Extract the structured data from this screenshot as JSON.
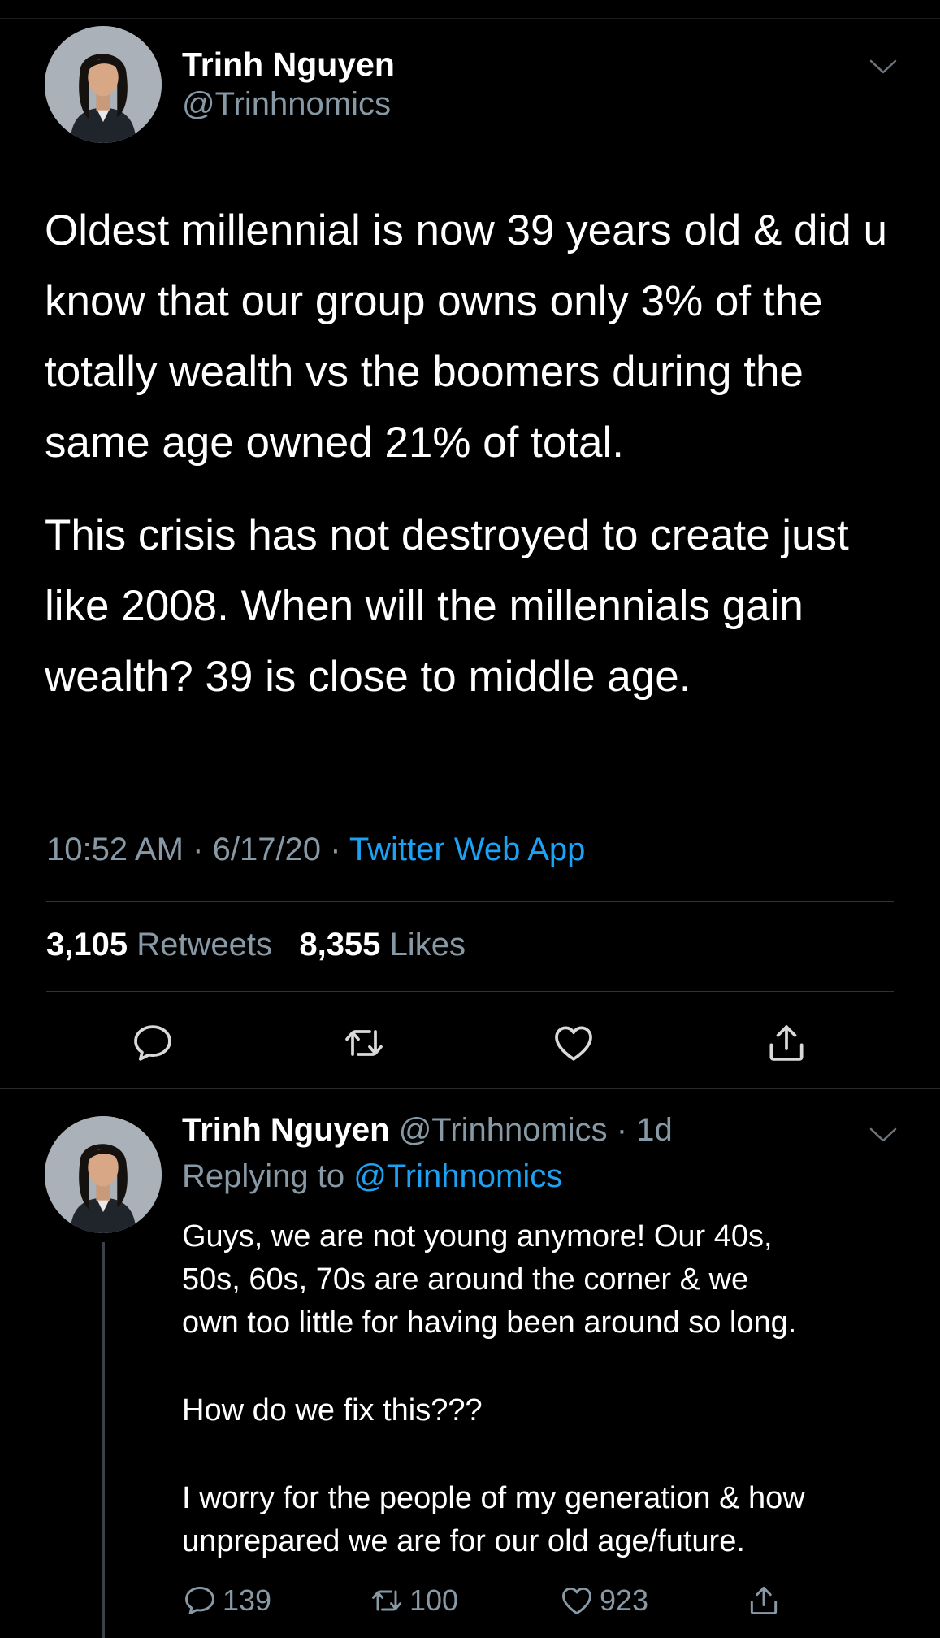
{
  "tweet": {
    "author": {
      "name": "Trinh Nguyen",
      "handle": "@Trinhnomics"
    },
    "paragraphs": [
      "Oldest millennial is now 39 years old & did u know that our group owns only 3% of the totally wealth vs the boomers during the same age owned 21% of total.",
      "This crisis has not destroyed to create just like 2008. When will the millennials gain wealth? 39 is close to middle age."
    ],
    "time": "10:52 AM",
    "date": "6/17/20",
    "separator": "·",
    "source": "Twitter Web App",
    "stats": {
      "retweets_count": "3,105",
      "retweets_label": "Retweets",
      "likes_count": "8,355",
      "likes_label": "Likes"
    },
    "actions": [
      "reply-icon",
      "retweet-icon",
      "like-icon",
      "share-icon"
    ]
  },
  "reply": {
    "author": {
      "name": "Trinh Nguyen",
      "handle": "@Trinhnomics",
      "age": "1d"
    },
    "replying_to_label": "Replying to",
    "replying_to_handle": "@Trinhnomics",
    "lines": [
      [
        "Guys, we are not young anymore! Our 40s,",
        "50s, 60s, 70s are around the corner & we",
        "own too little for having been around so long."
      ],
      [
        "How do we fix this???"
      ],
      [
        "I worry for the people of my generation & how",
        "unprepared we are for our old age/future."
      ]
    ],
    "counts": {
      "replies": "139",
      "retweets": "100",
      "likes": "923"
    }
  },
  "colors": {
    "background": "#000000",
    "text": "#ffffff",
    "muted": "#8899a6",
    "link": "#1da1f2",
    "divider": "#2f3336"
  }
}
